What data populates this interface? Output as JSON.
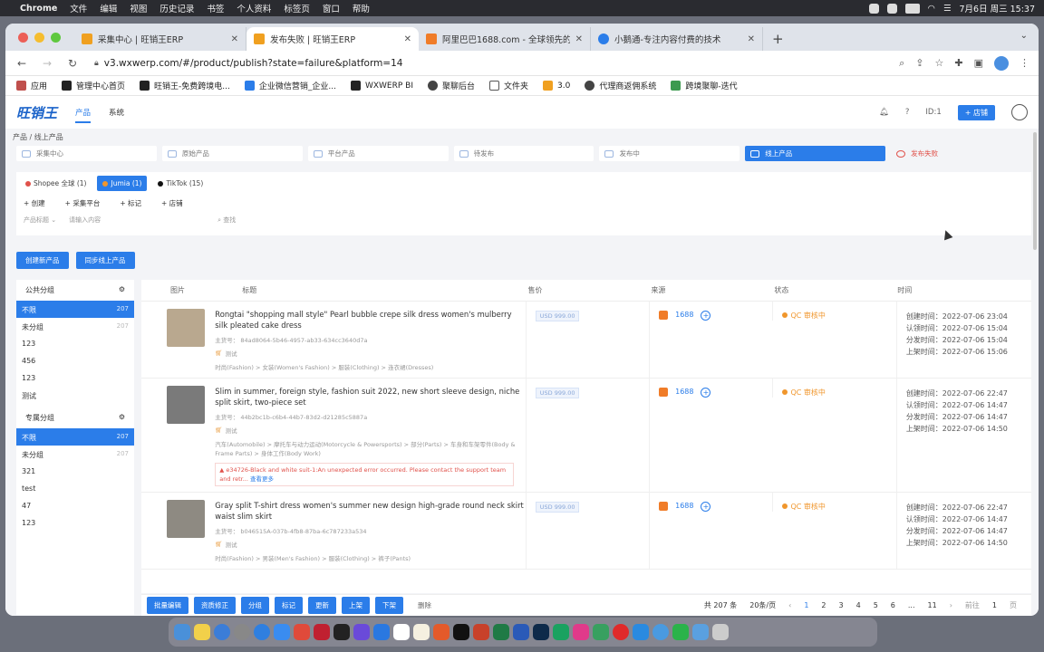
{
  "menubar": {
    "app": "Chrome",
    "items": [
      "文件",
      "编辑",
      "视图",
      "历史记录",
      "书签",
      "个人资料",
      "标签页",
      "窗口",
      "帮助"
    ],
    "datetime": "7月6日 周三 15:37"
  },
  "browser": {
    "tabs": [
      {
        "title": "采集中心 | 旺销王ERP",
        "favicon_color": "#f0a020"
      },
      {
        "title": "发布失败 | 旺销王ERP",
        "favicon_color": "#f0a020"
      },
      {
        "title": "阿里巴巴1688.com - 全球领先的",
        "favicon_color": "#f07c28"
      },
      {
        "title": "小鹅通-专注内容付费的技术",
        "favicon_color": "#2b7de9"
      }
    ],
    "url": "v3.wxwerp.com/#/product/publish?state=failure&platform=14",
    "bookmarks": [
      "应用",
      "管理中心首页",
      "旺销王-免费跨境电...",
      "企业微信营销_企业...",
      "WXWERP BI",
      "聚聊后台",
      "文件夹",
      "3.0",
      "代理商返佣系统",
      "跨境聚聊-迭代"
    ]
  },
  "app": {
    "logo": "旺销王",
    "nav": [
      "产品",
      "系统"
    ],
    "header_right": {
      "id_label": "ID:1",
      "store_button": "+ 店铺"
    },
    "breadcrumb": "产品 / 线上产品",
    "steps": [
      {
        "label": "采集中心"
      },
      {
        "label": "原始产品"
      },
      {
        "label": "平台产品"
      },
      {
        "label": "待发布"
      },
      {
        "label": "发布中"
      },
      {
        "label": "线上产品"
      },
      {
        "label": "发布失败"
      }
    ],
    "platforms": [
      {
        "label": "Shopee 全球 (1)"
      },
      {
        "label": "Jumia (1)"
      },
      {
        "label": "TikTok (15)"
      }
    ],
    "filters": [
      "+ 创建",
      "+ 采集平台",
      "+ 标记",
      "+ 店铺"
    ],
    "search": {
      "field": "产品标题",
      "placeholder": "请输入内容",
      "button": "查找"
    },
    "buttons": [
      "创建新产品",
      "同步线上产品"
    ],
    "sidebar": {
      "public_header": "公共分组",
      "public_groups": [
        {
          "name": "不限",
          "count": "207"
        },
        {
          "name": "未分组",
          "count": "207"
        },
        {
          "name": "123",
          "count": ""
        },
        {
          "name": "456",
          "count": ""
        },
        {
          "name": "123",
          "count": ""
        },
        {
          "name": "测试",
          "count": ""
        }
      ],
      "private_header": "专属分组",
      "private_groups": [
        {
          "name": "不限",
          "count": "207"
        },
        {
          "name": "未分组",
          "count": "207"
        },
        {
          "name": "321",
          "count": ""
        },
        {
          "name": "test",
          "count": ""
        },
        {
          "name": "47",
          "count": ""
        },
        {
          "name": "123",
          "count": ""
        }
      ]
    },
    "table": {
      "headers": [
        "图片",
        "标题",
        "售价",
        "来源",
        "状态",
        "时间"
      ],
      "rows": [
        {
          "title": "Rongtai \"shopping mall style\" Pearl bubble crepe silk dress women's mulberry silk pleated cake dress",
          "sku": "主货号： 84ad8064-5b46-4957-ab33-634cc3640d7a",
          "tag": "测试",
          "category": "时尚(Fashion) > 女装(Women's Fashion) > 服装(Clothing) > 连衣裙(Dresses)",
          "error": "",
          "error_more": "",
          "price": "USD 999.00",
          "source": "1688",
          "status": "QC 审核中",
          "times": [
            "创建时间：2022-07-06 23:04",
            "认领时间：2022-07-06 15:04",
            "分发时间：2022-07-06 15:04",
            "上架时间：2022-07-06 15:06"
          ],
          "thumb_color": "#b9a88f"
        },
        {
          "title": "Slim in summer, foreign style, fashion suit 2022, new short sleeve design, niche split skirt, two-piece set",
          "sku": "主货号： 44b2bc1b-c6b4-44b7-83d2-d21285c5887a",
          "tag": "测试",
          "category": "汽车(Automobile) > 摩托车与动力运动(Motorcycle & Powersports) > 部分(Parts) > 车身和车架零件(Body & Frame Parts) > 身体工作(Body Work)",
          "error": "e34726-Black and white suit-1:An unexpected error occurred. Please contact the support team and retr...",
          "error_more": "查看更多",
          "price": "USD 999.00",
          "source": "1688",
          "status": "QC 审核中",
          "times": [
            "创建时间：2022-07-06 22:47",
            "认领时间：2022-07-06 14:47",
            "分发时间：2022-07-06 14:47",
            "上架时间：2022-07-06 14:50"
          ],
          "thumb_color": "#7a7a7a"
        },
        {
          "title": "Gray split T-shirt dress women's summer new design high-grade round neck skirt waist slim skirt",
          "sku": "主货号： b046515A-037b-4fb8-87ba-6c787233a534",
          "tag": "测试",
          "category": "时尚(Fashion) > 男装(Men's Fashion) > 服装(Clothing) > 裤子(Pants)",
          "error": "",
          "error_more": "",
          "price": "USD 999.00",
          "source": "1688",
          "status": "QC 审核中",
          "times": [
            "创建时间：2022-07-06 22:47",
            "认领时间：2022-07-06 14:47",
            "分发时间：2022-07-06 14:47",
            "上架时间：2022-07-06 14:50"
          ],
          "thumb_color": "#8e8a82"
        }
      ]
    },
    "bottom_buttons": [
      "批量编辑",
      "资质修正",
      "分组",
      "标记",
      "更新",
      "上架",
      "下架"
    ],
    "bottom_delete": "删除",
    "pagination": {
      "total": "共 207 条",
      "per_page": "20条/页",
      "pages": [
        "1",
        "2",
        "3",
        "4",
        "5",
        "6",
        "...",
        "11"
      ],
      "goto_label": "前往",
      "goto_value": "1",
      "goto_suffix": "页"
    }
  },
  "colors": {
    "accent": "#2b7de9",
    "error": "#e0514a",
    "warning": "#f0962c"
  }
}
